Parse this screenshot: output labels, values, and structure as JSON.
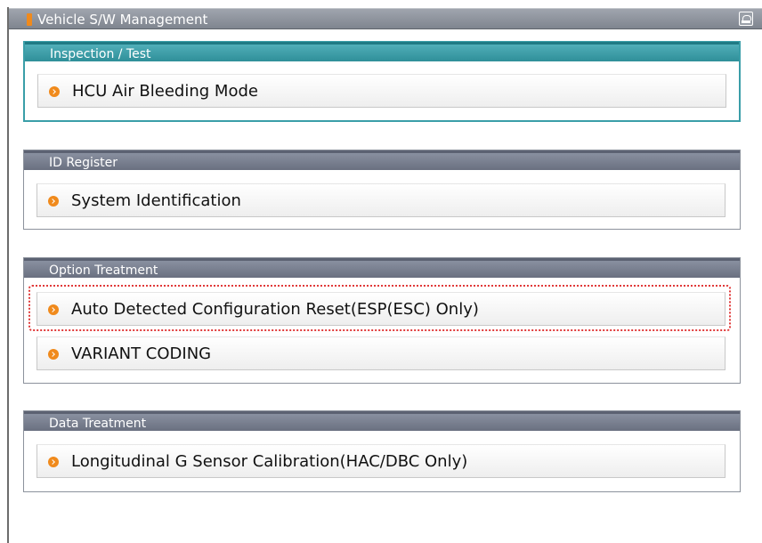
{
  "window": {
    "title": "Vehicle S/W Management",
    "title_icon": "printer-icon",
    "accent_color": "#f08a1c"
  },
  "groups": [
    {
      "header": "Inspection / Test",
      "active": true,
      "items": [
        {
          "label": "HCU Air Bleeding Mode",
          "icon": "orange-arrow-bullet-icon"
        }
      ]
    },
    {
      "header": "ID Register",
      "active": false,
      "items": [
        {
          "label": "System Identification",
          "icon": "orange-arrow-bullet-icon"
        }
      ]
    },
    {
      "header": "Option Treatment",
      "active": false,
      "items": [
        {
          "label": "Auto Detected Configuration Reset(ESP(ESC) Only)",
          "icon": "orange-arrow-bullet-icon",
          "highlighted": true
        },
        {
          "label": "VARIANT CODING",
          "icon": "orange-arrow-bullet-icon"
        }
      ]
    },
    {
      "header": "Data Treatment",
      "active": false,
      "items": [
        {
          "label": "Longitudinal G Sensor Calibration(HAC/DBC Only)",
          "icon": "orange-arrow-bullet-icon"
        }
      ]
    }
  ],
  "colors": {
    "header_active": "#3a9ea8",
    "header_inactive": "#7a808e",
    "highlight_outline": "#e03a3a"
  }
}
